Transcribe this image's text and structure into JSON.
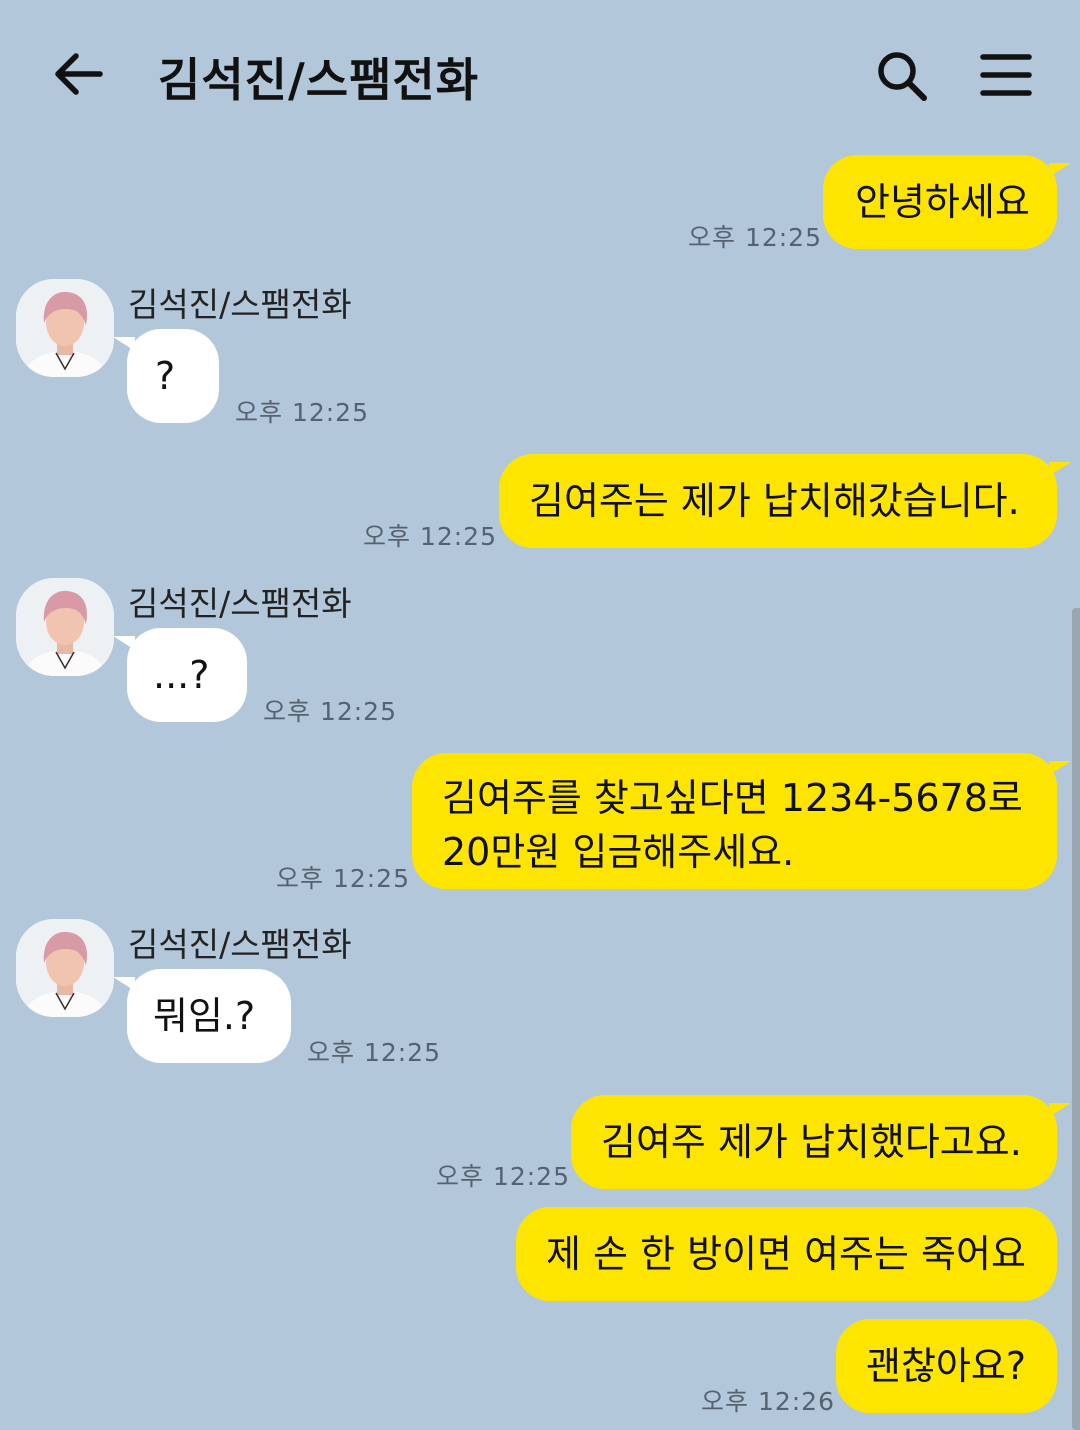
{
  "header": {
    "title": "김석진/스팸전화"
  },
  "contact": {
    "name": "김석진/스팸전화"
  },
  "messages": [
    {
      "text": "안녕하세요",
      "time": "오후 12:25"
    },
    {
      "text": "?",
      "time": "오후 12:25"
    },
    {
      "text": "김여주는 제가 납치해갔습니다.",
      "time": "오후 12:25"
    },
    {
      "text": "...?",
      "time": "오후 12:25"
    },
    {
      "line1": "김여주를 찾고싶다면 1234-5678로",
      "line2": "20만원 입금해주세요.",
      "time": "오후 12:25"
    },
    {
      "text": "뭐임.?",
      "time": "오후 12:25"
    },
    {
      "text": "김여주 제가 납치했다고요.",
      "time": "오후 12:25"
    },
    {
      "text": "제 손 한 방이면 여주는 죽어요"
    },
    {
      "text": "괜찮아요?",
      "time": "오후 12:26"
    }
  ],
  "colors": {
    "background": "#b2c7da",
    "my_bubble": "#fee500",
    "their_bubble": "#ffffff"
  },
  "icons": [
    "back-arrow-icon",
    "search-icon",
    "menu-icon"
  ]
}
